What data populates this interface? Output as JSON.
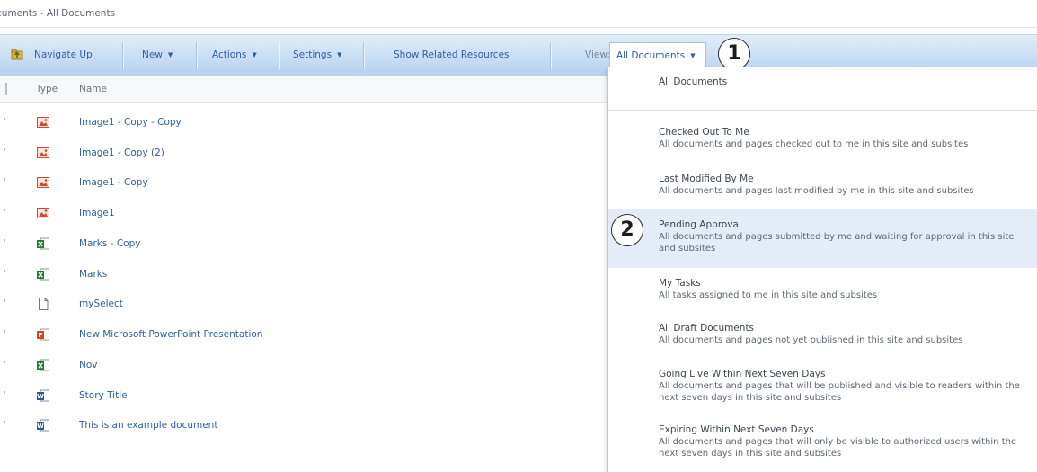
{
  "window": {
    "title": "cuments - All Documents"
  },
  "toolbar": {
    "navigate_up": "Navigate Up",
    "new": "New",
    "actions": "Actions",
    "settings": "Settings",
    "show_related": "Show Related Resources",
    "view_label": "View:",
    "view_value": "All Documents",
    "callout_1": "1"
  },
  "list": {
    "columns": {
      "type": "Type",
      "name": "Name"
    },
    "items": [
      {
        "name": "Image1 - Copy - Copy",
        "icon": "picture-icon"
      },
      {
        "name": "Image1 - Copy (2)",
        "icon": "picture-icon"
      },
      {
        "name": "Image1 - Copy",
        "icon": "picture-icon"
      },
      {
        "name": "Image1",
        "icon": "picture-icon"
      },
      {
        "name": "Marks - Copy",
        "icon": "excel-icon"
      },
      {
        "name": "Marks",
        "icon": "excel-icon"
      },
      {
        "name": "mySelect",
        "icon": "blank-document-icon"
      },
      {
        "name": "New Microsoft PowerPoint Presentation",
        "icon": "powerpoint-icon"
      },
      {
        "name": "Nov",
        "icon": "excel-icon"
      },
      {
        "name": "Story Title",
        "icon": "word-icon"
      },
      {
        "name": "This is an example document",
        "icon": "word-icon"
      }
    ]
  },
  "view_menu": {
    "callout_2": "2",
    "items": [
      {
        "title": "All Documents",
        "desc": ""
      },
      {
        "title": "Checked Out To Me",
        "desc": "All documents and pages checked out to me in this site and subsites"
      },
      {
        "title": "Last Modified By Me",
        "desc": "All documents and pages last modified by me in this site and subsites"
      },
      {
        "title": "Pending Approval",
        "desc": "All documents and pages submitted by me and waiting for approval in this site and subsites"
      },
      {
        "title": "My Tasks",
        "desc": "All tasks assigned to me in this site and subsites"
      },
      {
        "title": "All Draft Documents",
        "desc": "All documents and pages not yet published in this site and subsites"
      },
      {
        "title": "Going Live Within Next Seven Days",
        "desc": "All documents and pages that will be published and visible to readers within the next seven days in this site and subsites"
      },
      {
        "title": "Expiring Within Next Seven Days",
        "desc": "All documents and pages that will only be visible to authorized users within the next seven days in this site and subsites"
      }
    ]
  },
  "colors": {
    "link": "#2e5fa3",
    "toolbar": "#c9ddf5",
    "highlight": "#e4edf7"
  }
}
